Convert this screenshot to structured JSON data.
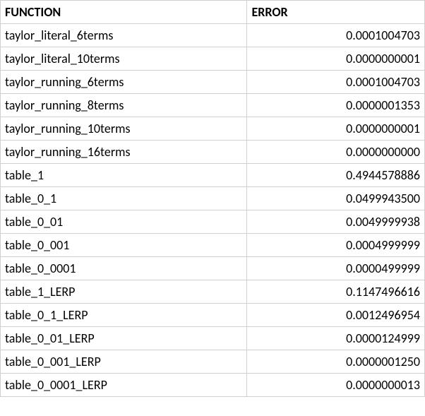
{
  "headers": {
    "function": "FUNCTION",
    "error": "ERROR"
  },
  "rows": [
    {
      "function": "taylor_literal_6terms",
      "error": "0.0001004703"
    },
    {
      "function": "taylor_literal_10terms",
      "error": "0.0000000001"
    },
    {
      "function": "taylor_running_6terms",
      "error": "0.0001004703"
    },
    {
      "function": "taylor_running_8terms",
      "error": "0.0000001353"
    },
    {
      "function": "taylor_running_10terms",
      "error": "0.0000000001"
    },
    {
      "function": "taylor_running_16terms",
      "error": "0.0000000000"
    },
    {
      "function": "table_1",
      "error": "0.4944578886"
    },
    {
      "function": "table_0_1",
      "error": "0.0499943500"
    },
    {
      "function": "table_0_01",
      "error": "0.0049999938"
    },
    {
      "function": "table_0_001",
      "error": "0.0004999999"
    },
    {
      "function": "table_0_0001",
      "error": "0.0000499999"
    },
    {
      "function": "table_1_LERP",
      "error": "0.1147496616"
    },
    {
      "function": "table_0_1_LERP",
      "error": "0.0012496954"
    },
    {
      "function": "table_0_01_LERP",
      "error": "0.0000124999"
    },
    {
      "function": "table_0_001_LERP",
      "error": "0.0000001250"
    },
    {
      "function": "table_0_0001_LERP",
      "error": "0.0000000013"
    }
  ]
}
